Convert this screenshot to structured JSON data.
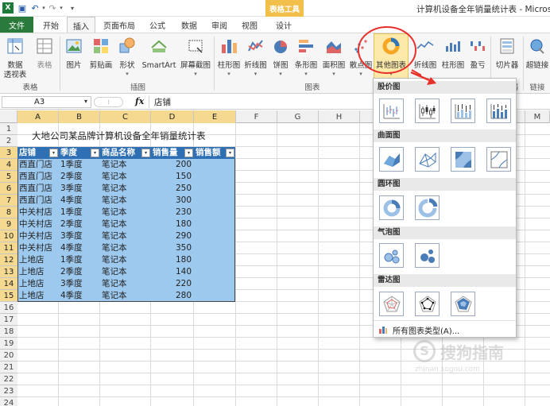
{
  "window": {
    "title": "计算机设备全年销量统计表 - Microso",
    "context_tab_group": "表格工具"
  },
  "tabs": [
    {
      "label": "文件"
    },
    {
      "label": "开始"
    },
    {
      "label": "插入"
    },
    {
      "label": "页面布局"
    },
    {
      "label": "公式"
    },
    {
      "label": "数据"
    },
    {
      "label": "审阅"
    },
    {
      "label": "视图"
    },
    {
      "label": "设计"
    }
  ],
  "ribbon": {
    "buttons": [
      {
        "label": "数据",
        "label2": "透视表"
      },
      {
        "label": "表格"
      },
      {
        "label": "图片"
      },
      {
        "label": "剪贴画"
      },
      {
        "label": "形状"
      },
      {
        "label": "SmartArt"
      },
      {
        "label": "屏幕截图"
      },
      {
        "label": "柱形图"
      },
      {
        "label": "折线图"
      },
      {
        "label": "饼图"
      },
      {
        "label": "条形图"
      },
      {
        "label": "面积图"
      },
      {
        "label": "散点图"
      },
      {
        "label": "其他图表"
      },
      {
        "label": "折线图"
      },
      {
        "label": "柱形图"
      },
      {
        "label": "盈亏"
      },
      {
        "label": "切片器"
      },
      {
        "label": "超链接"
      }
    ],
    "groups": [
      {
        "label": "表格"
      },
      {
        "label": "插图"
      },
      {
        "label": "图表"
      },
      {
        "label": "筛选器"
      },
      {
        "label": "链接"
      }
    ]
  },
  "formula_bar": {
    "name_box": "A3",
    "fx": "fx",
    "value": "店铺"
  },
  "columns": [
    "A",
    "B",
    "C",
    "D",
    "E",
    "F",
    "G",
    "H",
    "I",
    "J",
    "K",
    "L",
    "M"
  ],
  "sheet": {
    "title": "大地公司某品牌计算机设备全年销量统计表",
    "headers": [
      "店铺",
      "季度",
      "商品名称",
      "销售量",
      "销售额"
    ],
    "rows": [
      [
        "西直门店",
        "1季度",
        "笔记本",
        "200",
        ""
      ],
      [
        "西直门店",
        "2季度",
        "笔记本",
        "150",
        ""
      ],
      [
        "西直门店",
        "3季度",
        "笔记本",
        "250",
        ""
      ],
      [
        "西直门店",
        "4季度",
        "笔记本",
        "300",
        ""
      ],
      [
        "中关村店",
        "1季度",
        "笔记本",
        "230",
        ""
      ],
      [
        "中关村店",
        "2季度",
        "笔记本",
        "180",
        ""
      ],
      [
        "中关村店",
        "3季度",
        "笔记本",
        "290",
        ""
      ],
      [
        "中关村店",
        "4季度",
        "笔记本",
        "350",
        ""
      ],
      [
        "上地店",
        "1季度",
        "笔记本",
        "180",
        ""
      ],
      [
        "上地店",
        "2季度",
        "笔记本",
        "140",
        ""
      ],
      [
        "上地店",
        "3季度",
        "笔记本",
        "220",
        ""
      ],
      [
        "上地店",
        "4季度",
        "笔记本",
        "280",
        ""
      ]
    ],
    "row_numbers": [
      "1",
      "2",
      "3",
      "4",
      "5",
      "6",
      "7",
      "8",
      "9",
      "10",
      "11",
      "12",
      "13",
      "14",
      "15",
      "16",
      "17",
      "18",
      "19",
      "20",
      "21",
      "22",
      "23",
      "24"
    ]
  },
  "dropdown": {
    "sections": [
      {
        "label": "股价图"
      },
      {
        "label": "曲面图"
      },
      {
        "label": "圆环图"
      },
      {
        "label": "气泡图"
      },
      {
        "label": "雷达图"
      }
    ],
    "footer": "所有图表类型(A)..."
  },
  "watermark": {
    "text": "搜狗指南",
    "url": "zhinan.sogou.com"
  },
  "colors": {
    "file_tab": "#2a7a3b",
    "header_fill": "#2f6fb3",
    "data_fill": "#9ec9ee",
    "context_tab": "#f2c04a",
    "highlight_circle": "#e8302a"
  }
}
